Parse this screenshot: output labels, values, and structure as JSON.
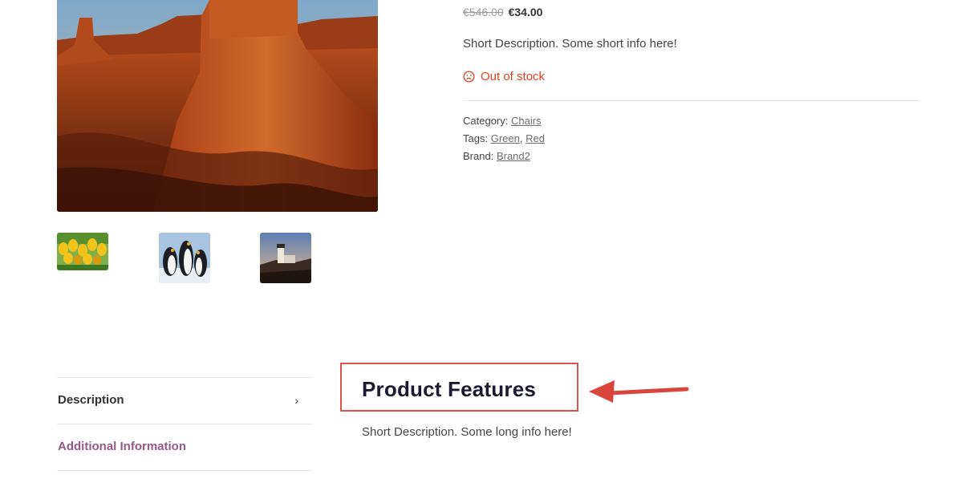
{
  "product": {
    "price_old": "€546.00",
    "price_new": "€34.00",
    "short_description": "Short Description. Some short info here!",
    "stock_status": "Out of stock",
    "meta": {
      "category_label": "Category:",
      "category": "Chairs",
      "tags_label": "Tags:",
      "tags": [
        "Green",
        "Red"
      ],
      "tag_separator": ",",
      "brand_label": "Brand:",
      "brand": "Brand2"
    }
  },
  "gallery": {
    "icons": [
      "desert-image",
      "tulips-image",
      "penguins-image",
      "lighthouse-image"
    ]
  },
  "tabs": [
    {
      "label": "Description",
      "active": false
    },
    {
      "label": "Additional Information",
      "active": true
    }
  ],
  "panel": {
    "title": "Product Features",
    "body": "Short Description. Some long info here!"
  },
  "colors": {
    "out_of_stock": "#e2401c",
    "active_tab": "#96588a",
    "highlight_box": "#d9534f"
  }
}
